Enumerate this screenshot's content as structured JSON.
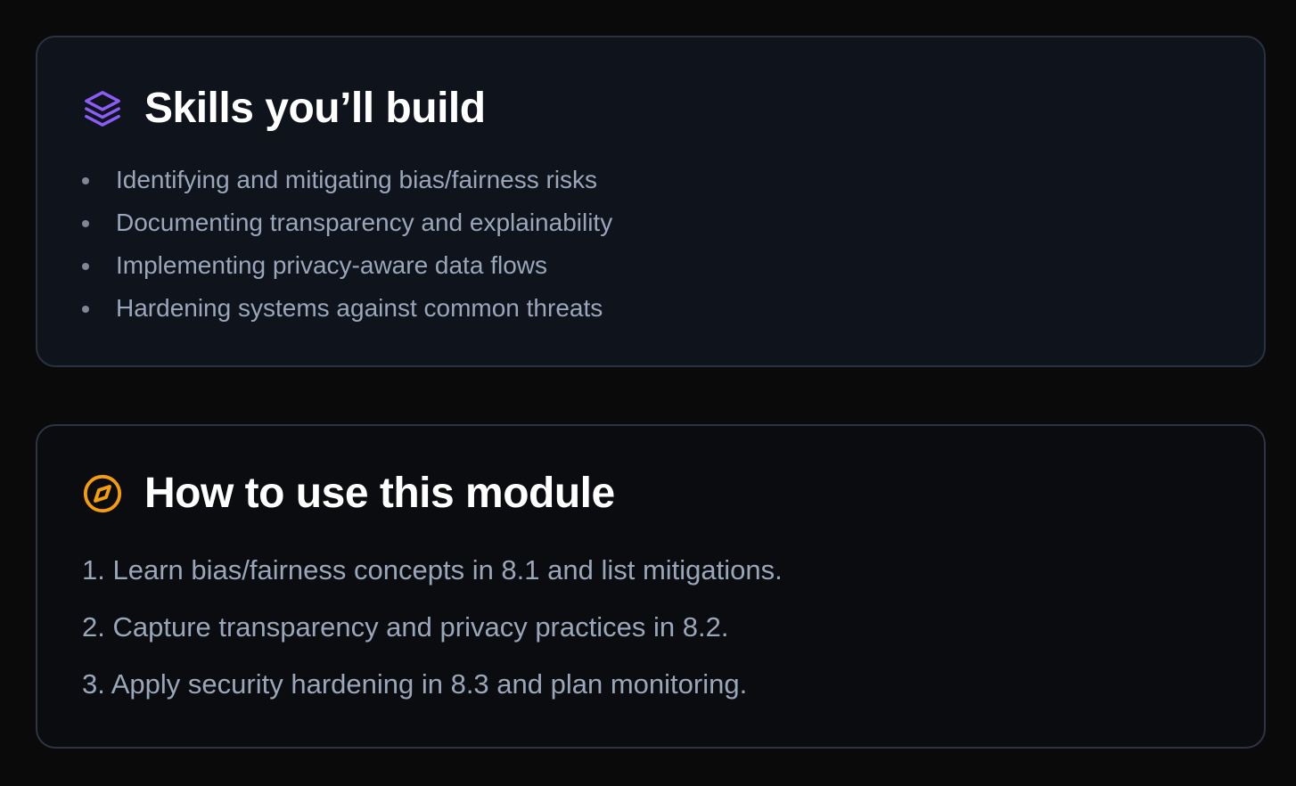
{
  "skills_card": {
    "icon": "layers-icon",
    "icon_color": "#8b5cf6",
    "title": "Skills you’ll build",
    "items": [
      {
        "label": "Identifying and mitigating bias/fairness risks"
      },
      {
        "label": "Documenting transparency and explainability"
      },
      {
        "label": "Implementing privacy-aware data flows"
      },
      {
        "label": "Hardening systems against common threats"
      }
    ]
  },
  "howto_card": {
    "icon": "compass-icon",
    "icon_color": "#f59e0b",
    "title": "How to use this module",
    "steps": [
      {
        "label": "1. Learn bias/fairness concepts in 8.1 and list mitigations."
      },
      {
        "label": "2. Capture transparency and privacy practices in 8.2."
      },
      {
        "label": "3. Apply security hardening in 8.3 and plan monitoring."
      }
    ]
  }
}
